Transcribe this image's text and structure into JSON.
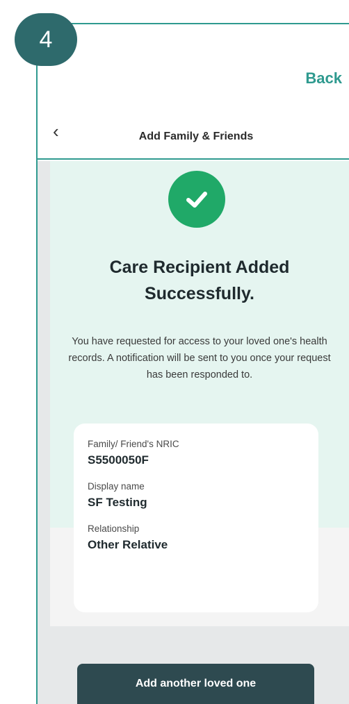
{
  "step": {
    "number": "4"
  },
  "nav": {
    "back_label": "Back"
  },
  "header": {
    "title": "Add Family & Friends",
    "back_icon": "chevron-left-icon"
  },
  "success": {
    "icon": "check-circle-icon",
    "title": "Care Recipient Added Successfully.",
    "description": "You have requested for access to your loved one's health records. A notification will be sent to you once your request has been responded to."
  },
  "details": [
    {
      "label": "Family/ Friend's NRIC",
      "value": "S5500050F"
    },
    {
      "label": "Display name",
      "value": "SF Testing"
    },
    {
      "label": "Relationship",
      "value": "Other Relative"
    }
  ],
  "actions": {
    "add_another_label": "Add another loved one"
  },
  "colors": {
    "accent": "#2f9a8f",
    "success": "#20a968",
    "button": "#2e4a50",
    "mint_bg": "#e5f5f0"
  }
}
